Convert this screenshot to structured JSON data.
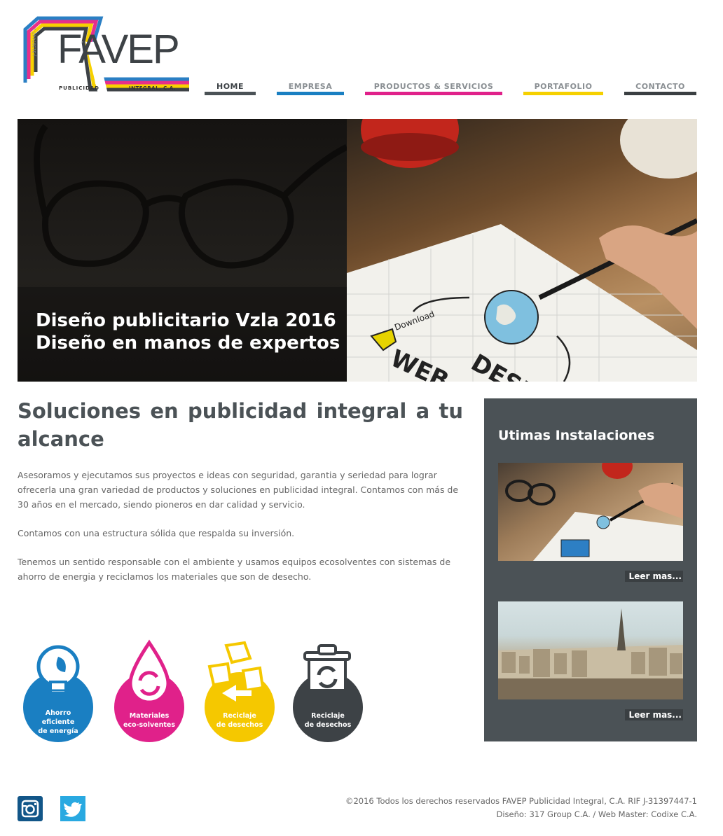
{
  "brand": {
    "name": "FAVEP",
    "sub_left": "PUBLICIDAD",
    "sub_right": "INTEGRAL, C.A.",
    "rif": "J-31397447-1",
    "colors": [
      "#2a7fc4",
      "#e62f8b",
      "#f7d100",
      "#3d4246"
    ]
  },
  "nav": {
    "items": [
      {
        "label": "HOME",
        "color": "#4b5256",
        "active": true
      },
      {
        "label": "EMPRESA",
        "color": "#1a7fc2",
        "active": false
      },
      {
        "label": "PRODUCTOS & SERVICIOS",
        "color": "#e0218a",
        "active": false
      },
      {
        "label": "PORTAFOLIO",
        "color": "#f5d000",
        "active": false
      },
      {
        "label": "CONTACTO",
        "color": "#3a3f42",
        "active": false
      }
    ]
  },
  "hero": {
    "title_line1": "Diseño publicitario Vzla 2016",
    "title_line2": "Diseño en manos de expertos",
    "drawing_text_1": "Download",
    "drawing_text_2": "WEB",
    "drawing_text_3": "DESIGN"
  },
  "main": {
    "heading": "Soluciones en publicidad integral a tu alcance",
    "paragraphs": [
      "Asesoramos y ejecutamos sus proyectos e ideas con seguridad, garantia y seriedad para lograr ofrecerla una gran variedad de productos y soluciones en publicidad integral. Contamos con más de 30 años en el mercado, siendo pioneros en dar calidad y servicio.",
      "Contamos con una estructura sólida que respalda su inversión.",
      "Tenemos un sentido responsable con el ambiente y usamos equipos ecosolventes con sistemas de ahorro de energia y reciclamos los materiales que son de desecho."
    ],
    "eco_badges": [
      {
        "label_lines": [
          "Ahorro",
          "eficiente",
          "de energía"
        ],
        "color": "#1a7fc2",
        "icon": "lightbulb-icon"
      },
      {
        "label_lines": [
          "Materiales",
          "eco-solventes"
        ],
        "color": "#e0218a",
        "icon": "drop-recycle-icon"
      },
      {
        "label_lines": [
          "Reciclaje",
          "de desechos"
        ],
        "color": "#f5c800",
        "icon": "recycle-arrows-icon"
      },
      {
        "label_lines": [
          "Reciclaje",
          "de desechos"
        ],
        "color": "#3d4246",
        "icon": "trash-recycle-icon"
      }
    ]
  },
  "sidebar": {
    "title": "Utimas Instalaciones",
    "items": [
      {
        "read_more": "Leer mas..."
      },
      {
        "read_more": "Leer mas..."
      }
    ]
  },
  "footer": {
    "social": [
      "instagram-icon",
      "twitter-icon"
    ],
    "copyright": "©2016 Todos los derechos reservados FAVEP Publicidad Integral, C.A. RIF J-31397447-1",
    "credits": "Diseño: 317 Group C.A. / Web Master: Codixe C.A."
  }
}
